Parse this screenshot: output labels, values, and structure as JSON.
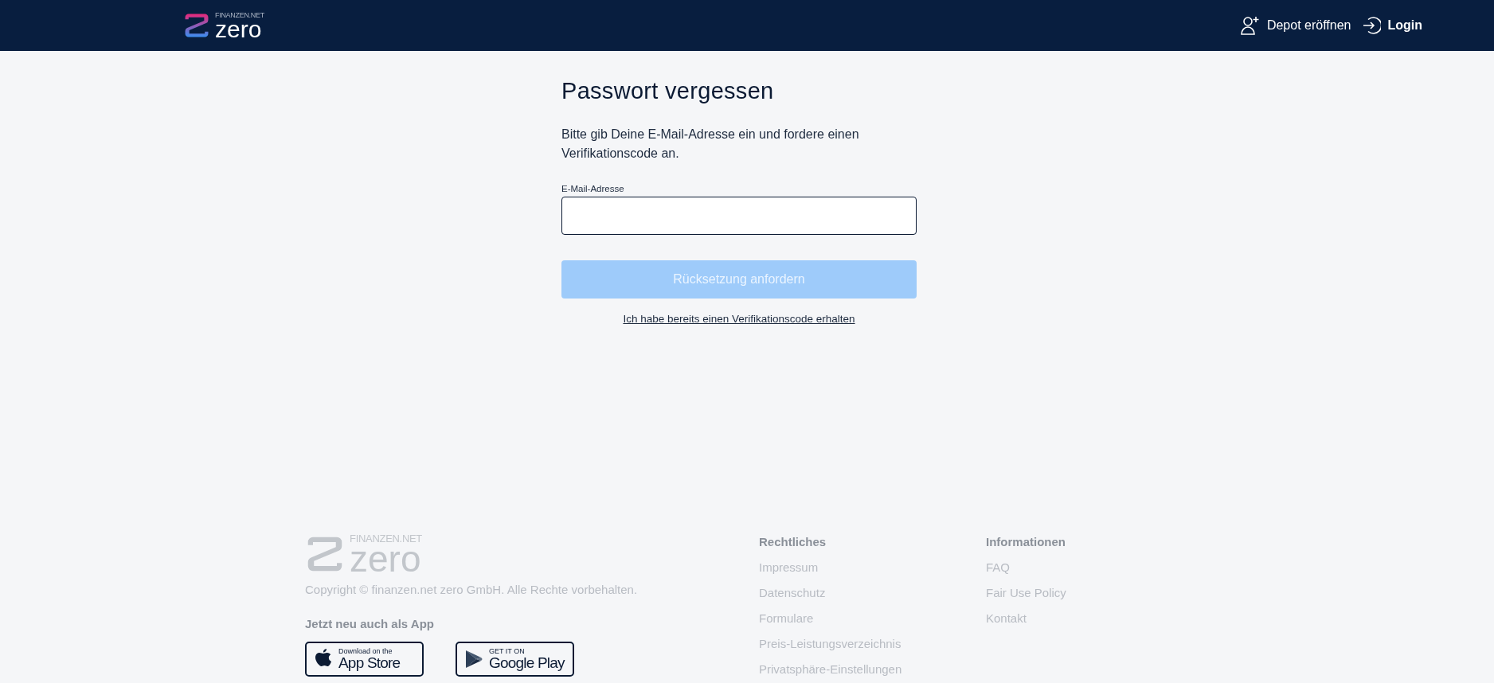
{
  "header": {
    "logo": {
      "brand": "FINANZEN.NET",
      "name": "zero"
    },
    "nav": [
      {
        "kind": "signup",
        "label": "Depot eröffnen"
      },
      {
        "kind": "login",
        "label": "Login"
      }
    ]
  },
  "form": {
    "title": "Passwort vergessen",
    "intro": "Bitte gib Deine E-Mail-Adresse ein und fordere einen Verifikationscode an.",
    "email_label": "E-Mail-Adresse",
    "submit": {
      "label": "Rücksetzung anfordern",
      "disabled": true
    },
    "link": "Ich habe bereits einen Verifikationscode erhalten"
  },
  "footer": {
    "logo": {
      "brand": "FINANZEN.NET",
      "name": "zero"
    },
    "copyright": "Copyright © finanzen.net zero GmbH. Alle Rechte vorbehalten.",
    "app_heading": "Jetzt neu auch als App",
    "badges": [
      {
        "kind": "apple",
        "small": "Download on the",
        "big": "App Store"
      },
      {
        "kind": "google",
        "small": "GET IT ON",
        "big": "Google Play"
      }
    ],
    "columns": [
      {
        "title": "Rechtliches",
        "links": [
          "Impressum",
          "Datenschutz",
          "Formulare",
          "Preis-Leistungsverzeichnis",
          "Privatsphäre-Einstellungen"
        ]
      },
      {
        "title": "Informationen",
        "links": [
          "FAQ",
          "Fair Use Policy",
          "Kontakt"
        ]
      }
    ]
  }
}
